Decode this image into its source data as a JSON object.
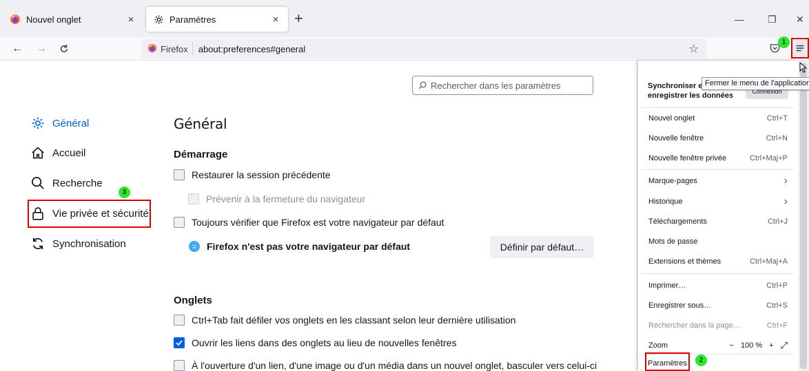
{
  "tabs": [
    {
      "title": "Nouvel onglet",
      "close": "×"
    },
    {
      "title": "Paramètres",
      "close": "×"
    }
  ],
  "new_tab_symbol": "+",
  "window_controls": {
    "minimize": "—",
    "restore": "❐",
    "close": "✕"
  },
  "nav": {
    "back": "←",
    "forward": "→",
    "reload": "C"
  },
  "url": {
    "identity": "Firefox",
    "address": "about:preferences#general",
    "star": "☆"
  },
  "badges": {
    "menu": "1",
    "params": "2",
    "privacy": "3"
  },
  "search": {
    "placeholder": "Rechercher dans les paramètres"
  },
  "sidebar": {
    "items": [
      {
        "label": "Général",
        "icon": "gear-icon"
      },
      {
        "label": "Accueil",
        "icon": "home-icon"
      },
      {
        "label": "Recherche",
        "icon": "search-icon"
      },
      {
        "label": "Vie privée et sécurité",
        "icon": "lock-icon"
      },
      {
        "label": "Synchronisation",
        "icon": "sync-icon"
      }
    ]
  },
  "main": {
    "title": "Général",
    "startup": {
      "heading": "Démarrage",
      "restore_session": "Restaurer la session précédente",
      "warn_on_quit": "Prévenir à la fermeture du navigateur",
      "check_default": "Toujours vérifier que Firefox est votre navigateur par défaut",
      "not_default": "Firefox n'est pas votre navigateur par défaut",
      "set_default_button": "Définir par défaut…"
    },
    "tabs_section": {
      "heading": "Onglets",
      "ctrl_tab": "Ctrl+Tab fait défiler vos onglets en les classant selon leur dernière utilisation",
      "open_links": "Ouvrir les liens dans des onglets au lieu de nouvelles fenêtres",
      "switch_to": "À l'ouverture d'un lien, d'une image ou d'un média dans un nouvel onglet, basculer vers celui-ci"
    }
  },
  "app_menu": {
    "sync_title": "Synchroniser et enregistrer les données",
    "sync_title_line1": "Synchroniser et",
    "sync_title_line2": "enregistrer les données",
    "connexion": "Connexion",
    "tooltip": "Fermer le menu de l'application",
    "items": [
      {
        "label": "Nouvel onglet",
        "shortcut": "Ctrl+T"
      },
      {
        "label": "Nouvelle fenêtre",
        "shortcut": "Ctrl+N"
      },
      {
        "label": "Nouvelle fenêtre privée",
        "shortcut": "Ctrl+Maj+P"
      },
      {
        "label": "Marque-pages",
        "shortcut": "›"
      },
      {
        "label": "Historique",
        "shortcut": "›"
      },
      {
        "label": "Téléchargements",
        "shortcut": "Ctrl+J"
      },
      {
        "label": "Mots de passe",
        "shortcut": ""
      },
      {
        "label": "Extensions et thèmes",
        "shortcut": "Ctrl+Maj+A"
      },
      {
        "label": "Imprimer…",
        "shortcut": "Ctrl+P"
      },
      {
        "label": "Enregistrer sous…",
        "shortcut": "Ctrl+S"
      },
      {
        "label": "Rechercher dans la page…",
        "shortcut": "Ctrl+F"
      },
      {
        "label": "Zoom",
        "shortcut": ""
      },
      {
        "label": "Paramètres",
        "shortcut": ""
      }
    ],
    "zoom": {
      "minus": "−",
      "value": "100 %",
      "plus": "+",
      "fullscreen": "⤢"
    }
  },
  "colors": {
    "accent": "#0061e0",
    "highlight": "#e10000",
    "badge": "#2ee62e"
  }
}
